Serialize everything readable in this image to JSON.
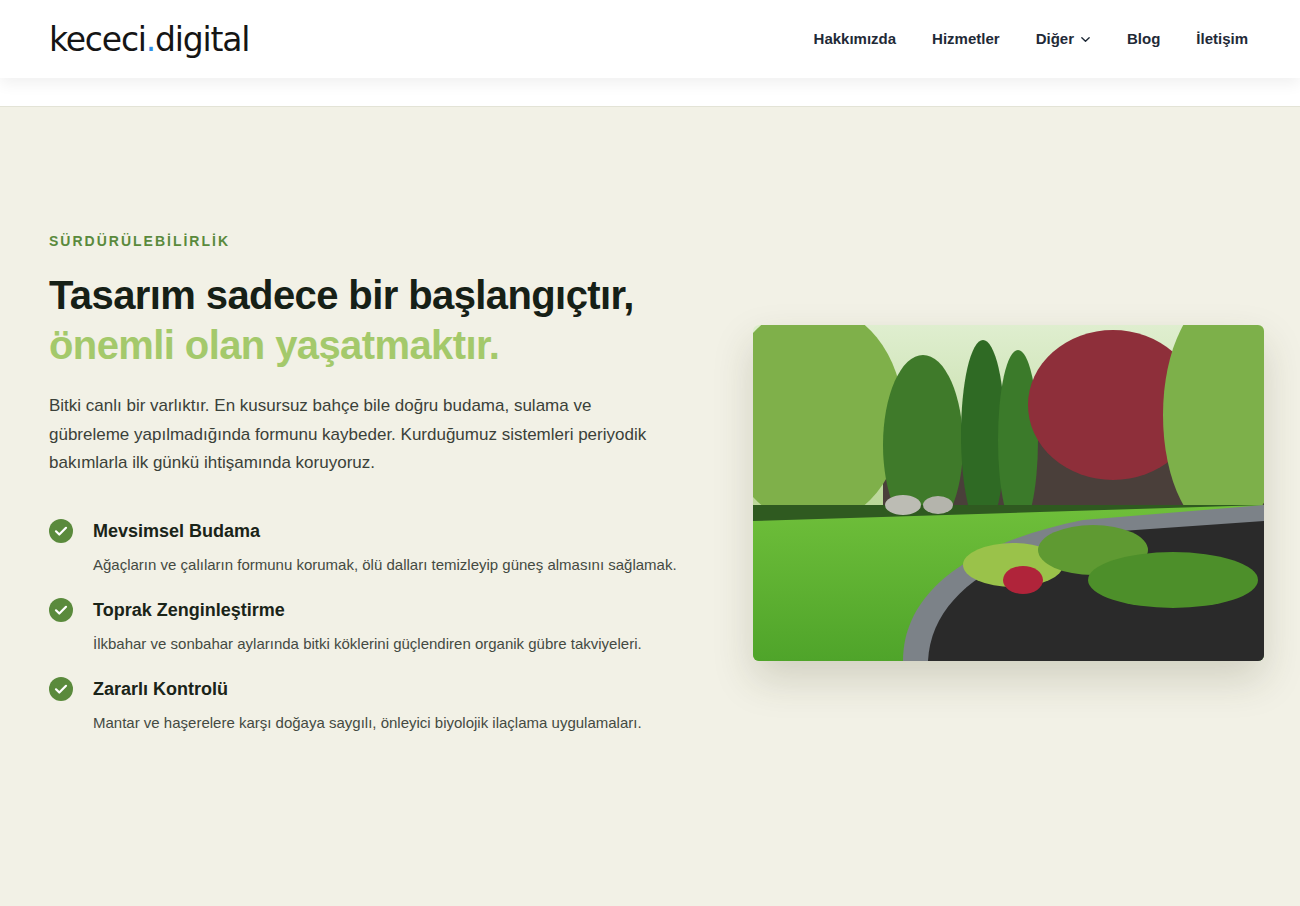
{
  "header": {
    "logo": {
      "text": "kececi",
      "dot": ".",
      "suffix": "digital"
    },
    "nav": [
      {
        "label": "Hakkımızda",
        "has_menu": false
      },
      {
        "label": "Hizmetler",
        "has_menu": false
      },
      {
        "label": "Diğer",
        "has_menu": true
      },
      {
        "label": "Blog",
        "has_menu": false
      },
      {
        "label": "İletişim",
        "has_menu": false
      }
    ]
  },
  "section": {
    "eyebrow": "SÜRDÜRÜLEBİLİRLİK",
    "title": "Tasarım sadece bir başlangıçtır,",
    "title_highlight": "önemli olan yaşatmaktır.",
    "text": "Bitki canlı bir varlıktır. En kusursuz bahçe bile doğru budama, sulama ve gübreleme yapılmadığında formunu kaybeder. Kurduğumuz sistemleri periyodik bakımlarla ilk günkü ihtişamında koruyoruz.",
    "features": [
      {
        "title": "Mevsimsel Budama",
        "description": "Ağaçların ve çalıların formunu korumak, ölü dalları temizleyip güneş almasını sağlamak."
      },
      {
        "title": "Toprak Zenginleştirme",
        "description": "İlkbahar ve sonbahar aylarında bitki köklerini güçlendiren organik gübre takviyeleri."
      },
      {
        "title": "Zararlı Kontrolü",
        "description": "Mantar ve haşerelere karşı doğaya saygılı, önleyici biyolojik ilaçlama uygulamaları."
      }
    ]
  }
}
